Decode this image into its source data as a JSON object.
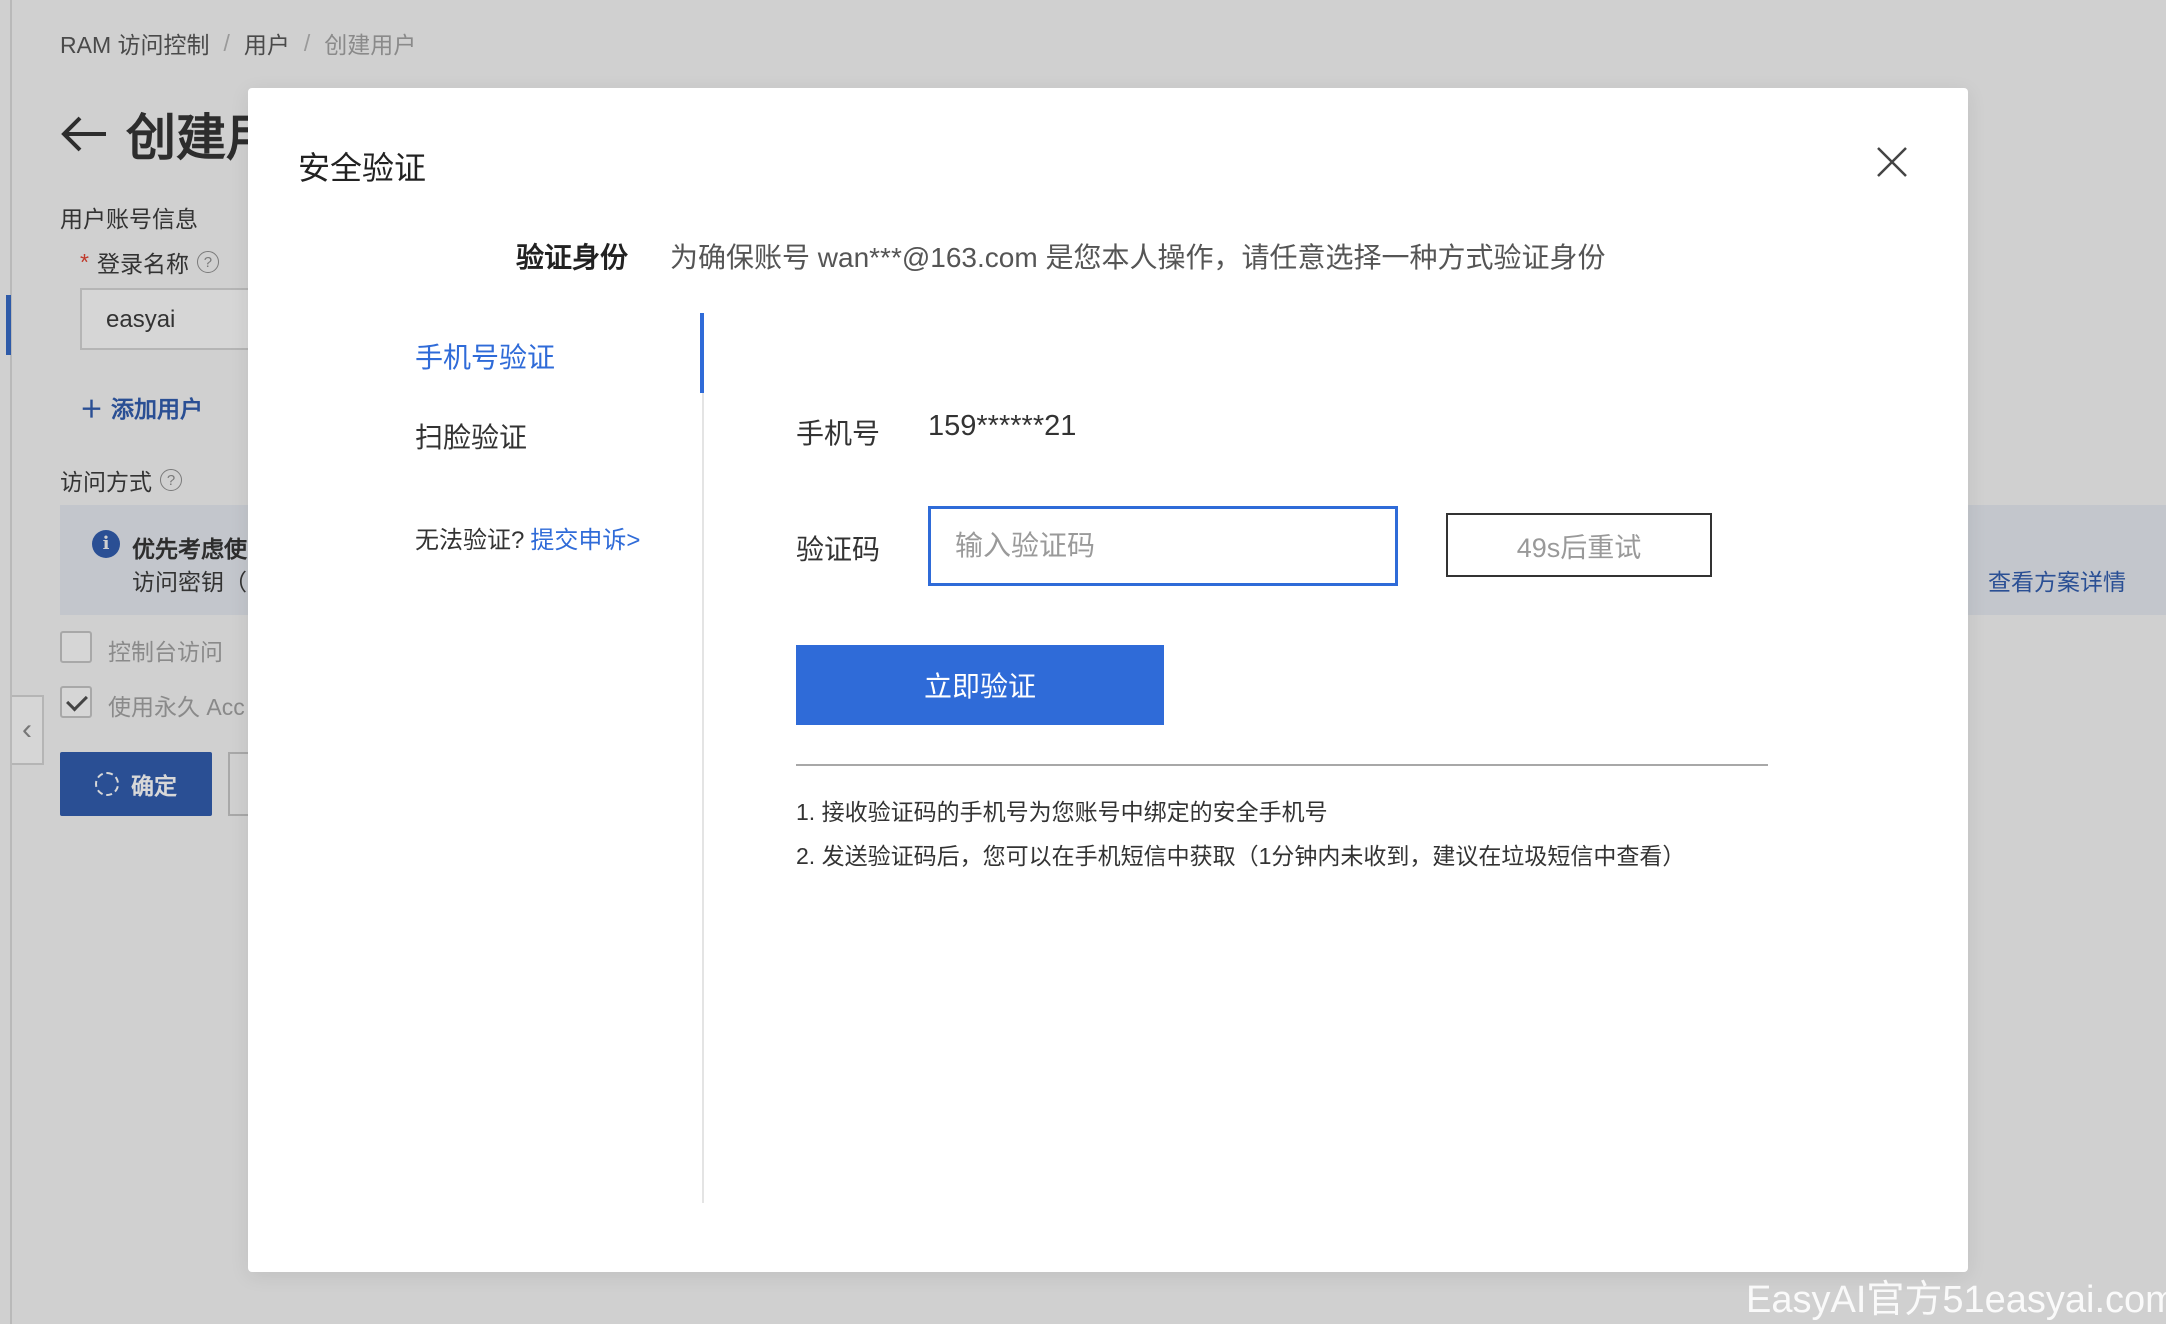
{
  "background": {
    "breadcrumb": [
      "RAM 访问控制",
      "用户",
      "创建用户"
    ],
    "page_title": "创建用",
    "section_account": "用户账号信息",
    "login_name_label": "登录名称",
    "login_name_value": "easyai",
    "add_user": "添加用户",
    "access_method_label": "访问方式",
    "info_line1": "优先考虑使",
    "info_line2": "访问密钥（",
    "info_link": "查看方案详情",
    "console_access": "控制台访问",
    "permanent_access": "使用永久 Acc",
    "confirm_button": "确定"
  },
  "modal": {
    "title": "安全验证",
    "verify_identity_label": "验证身份",
    "verify_identity_desc": "为确保账号 wan***@163.com 是您本人操作，请任意选择一种方式验证身份",
    "nav": [
      {
        "label": "手机号验证",
        "active": true
      },
      {
        "label": "扫脸验证",
        "active": false
      }
    ],
    "cant_verify_text": "无法验证?",
    "cant_verify_link": "提交申诉>",
    "phone_label": "手机号",
    "phone_value": "159******21",
    "code_label": "验证码",
    "code_placeholder": "输入验证码",
    "code_value": "",
    "retry_label": "49s后重试",
    "submit_label": "立即验证",
    "tips": [
      "1. 接收验证码的手机号为您账号中绑定的安全手机号",
      "2. 发送验证码后，您可以在手机短信中获取（1分钟内未收到，建议在垃圾短信中查看）"
    ]
  },
  "watermark": "EasyAI官方51easyai.com",
  "colors": {
    "accent": "#2f6bd8",
    "overlay": "#cbcbcb"
  }
}
